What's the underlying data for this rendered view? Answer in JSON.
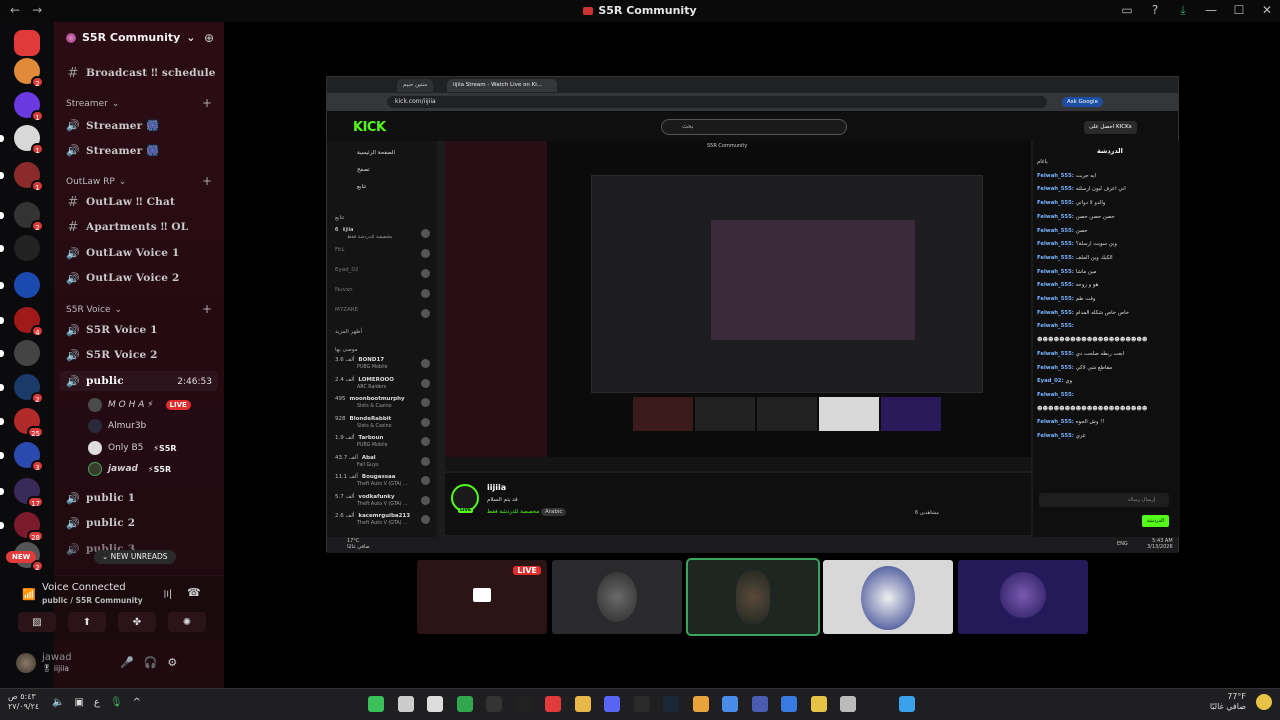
{
  "window": {
    "title": "S5R Community",
    "back": "←",
    "forward": "→",
    "controls": [
      "▭",
      "?",
      "⤓",
      "—",
      "☐",
      "✕"
    ]
  },
  "rail": {
    "servers": [
      {
        "name": "discord-home",
        "color": "#e03a3a",
        "badge": ""
      },
      {
        "name": "server-orange",
        "color": "#e08a3a",
        "badge": "2"
      },
      {
        "name": "server-purple",
        "color": "#6a3ae0",
        "badge": "1"
      },
      {
        "name": "server-white",
        "color": "#d8d8d8",
        "badge": "1"
      },
      {
        "name": "server-red-figure",
        "color": "#8a2a2a",
        "badge": "1"
      },
      {
        "name": "server-dark",
        "color": "#333333",
        "badge": "2"
      },
      {
        "name": "server-vg",
        "color": "#222222",
        "badge": ""
      },
      {
        "name": "server-blue-v",
        "color": "#1a4ab0",
        "badge": ""
      },
      {
        "name": "server-red-wings",
        "color": "#a01a1a",
        "badge": "4"
      },
      {
        "name": "server-northside",
        "color": "#444444",
        "badge": ""
      },
      {
        "name": "server-blue",
        "color": "#1a3a6a",
        "badge": "2"
      },
      {
        "name": "server-red-fire",
        "color": "#b02a2a",
        "badge": "25"
      },
      {
        "name": "server-blue-dots",
        "color": "#2a4ab0",
        "badge": "3"
      },
      {
        "name": "server-purple-2",
        "color": "#3a2a5a",
        "badge": "17"
      },
      {
        "name": "server-red-3",
        "color": "#7a1a2a",
        "badge": "28"
      },
      {
        "name": "server-small",
        "color": "#555555",
        "badge": "2"
      }
    ],
    "new_label": "NEW"
  },
  "sidebar": {
    "guild_name": "S5R Community",
    "channels": [
      {
        "type": "text",
        "label": "Broadcast ‼ schedule"
      },
      {
        "type": "category",
        "label": "Streamer"
      },
      {
        "type": "voice",
        "label": "Streamer 🎆"
      },
      {
        "type": "voice",
        "label": "Streamer 🎆"
      },
      {
        "type": "category",
        "label": "OutLaw RP"
      },
      {
        "type": "text",
        "label": "OutLaw ‼ Chat"
      },
      {
        "type": "text",
        "label": "Apartments ‼ OL"
      },
      {
        "type": "voice",
        "label": "OutLaw Voice 1"
      },
      {
        "type": "voice",
        "label": "OutLaw Voice 2"
      },
      {
        "type": "category",
        "label": "S5R Voice"
      },
      {
        "type": "voice",
        "label": "S5R Voice 1"
      },
      {
        "type": "voice",
        "label": "S5R Voice 2"
      },
      {
        "type": "voice",
        "label": "public"
      },
      {
        "type": "voice",
        "label": "public 1"
      },
      {
        "type": "voice",
        "label": "public 2"
      },
      {
        "type": "voice",
        "label": "public 3"
      }
    ],
    "public_timer": "2:46:53",
    "voice_users": [
      {
        "name": "M O H A ⚡",
        "live": "LIVE",
        "tag": ""
      },
      {
        "name": "Almur3b",
        "live": "",
        "tag": ""
      },
      {
        "name": "Only B5",
        "live": "",
        "tag": "⚡S5R"
      },
      {
        "name": "jawad",
        "live": "",
        "tag": "⚡S5R"
      }
    ],
    "new_unreads": "NEW UNREADS"
  },
  "voice_panel": {
    "title": "Voice Connected",
    "subtitle": "public / S5R Community"
  },
  "user": {
    "name": "jawad",
    "status": "🎖 iijiia"
  },
  "browser": {
    "tabs": [
      "ستين حبيم",
      "iijiia Stream - Watch Live on Ki..."
    ],
    "url": "kick.com/iijiia",
    "ask_google": "Ask Google",
    "kick_logo": "KICK",
    "search_placeholder": "بحث",
    "get_kicks": "احصل على KICKs",
    "side_nav": [
      "الصفحة الرئيسية",
      "تصفح",
      "تتابع"
    ],
    "following_label": "تتابع",
    "channels": [
      {
        "name": "iijiia",
        "sub": "مخصصة للدردشة فقط",
        "count": "6"
      },
      {
        "name": "FitL",
        "sub": "",
        "count": ""
      },
      {
        "name": "Eyad_02",
        "sub": "",
        "count": ""
      },
      {
        "name": "Nuvxn",
        "sub": "",
        "count": ""
      },
      {
        "name": "M7ZARE",
        "sub": "",
        "count": ""
      }
    ],
    "show_more": "أظهر المزيد",
    "recommended_label": "موصى بها",
    "recommended": [
      {
        "count": "3.6 ألف",
        "name": "BOND17",
        "game": "PUBG Mobile"
      },
      {
        "count": "2.4 ألف",
        "name": "LOMEROOO",
        "game": "ARC Raiders"
      },
      {
        "count": "495",
        "name": "moonbootmurphy",
        "game": "Slots & Casino"
      },
      {
        "count": "928",
        "name": "BlondeRabbit",
        "game": "Slots & Casino"
      },
      {
        "count": "1.9 ألف",
        "name": "Tarboun",
        "game": "PUBG Mobile"
      },
      {
        "count": "43.7 ألف",
        "name": "Abal",
        "game": "Fall Guys"
      },
      {
        "count": "11.1 ألف",
        "name": "Bougassaa",
        "game": "Theft Auto V (GTA) ..."
      },
      {
        "count": "5.7 ألف",
        "name": "vodkafunky",
        "game": "Theft Auto V (GTA) ..."
      },
      {
        "count": "2.6 ألف",
        "name": "kacemrguiba213",
        "game": "Theft Auto V (GTA) ..."
      }
    ],
    "nested_title": "S5R Community",
    "stream": {
      "name": "iijiia",
      "title": "قد يتم السلام",
      "category": "مخصصة للدردشة فقط",
      "language": "Arabic",
      "live": "LIVE",
      "viewers": "6 مشاهدين"
    },
    "chat": {
      "title": "الدردشة",
      "lines": [
        {
          "user": "",
          "msg": "ياغام"
        },
        {
          "user": "Felwah_555:",
          "msg": "ايه جربت"
        },
        {
          "user": "Felwah_555:",
          "msg": "اني اعرف ليون ارسلته"
        },
        {
          "user": "Felwah_555:",
          "msg": "والدو لا دواتي"
        },
        {
          "user": "Felwah_555:",
          "msg": "حصن حصن حصن"
        },
        {
          "user": "Felwah_555:",
          "msg": "حصن"
        },
        {
          "user": "Felwah_555:",
          "msg": "وين سويت ارسلة؟"
        },
        {
          "user": "Felwah_555:",
          "msg": "الكيك وين الملف"
        },
        {
          "user": "Felwah_555:",
          "msg": "مين ماشا"
        },
        {
          "user": "Felwah_555:",
          "msg": "هو و زوجه"
        },
        {
          "user": "Felwah_555:",
          "msg": "وقت طم"
        },
        {
          "user": "Felwah_555:",
          "msg": "خاص خاص شكله المدام"
        },
        {
          "user": "Felwah_555:",
          "msg": ""
        },
        {
          "user": "",
          "msg": "☻☻☻☻☻☻☻☻☻☻☻☻☻☻☻☻☻☻☻☻"
        },
        {
          "user": "Felwah_555:",
          "msg": "ابعت ربطه صلحت دي"
        },
        {
          "user": "Felwah_555:",
          "msg": "مقاطع شي لاكي"
        },
        {
          "user": "Eyad_02:",
          "msg": "وي"
        },
        {
          "user": "Felwah_555:",
          "msg": ""
        },
        {
          "user": "",
          "msg": "☻☻☻☻☻☻☻☻☻☻☻☻☻☻☻☻☻☻☻☻"
        },
        {
          "user": "Felwah_555:",
          "msg": "وش الجوه !!"
        },
        {
          "user": "Felwah_555:",
          "msg": "غري"
        }
      ],
      "input_placeholder": "إرسال رسالة",
      "send_label": "الدردشة"
    },
    "taskbar": {
      "temp": "17°C",
      "weather": "صافي غالبًا",
      "lang": "ENG",
      "time": "5:43 AM",
      "date": "3/13/2026"
    }
  },
  "tiles": [
    {
      "name": "tile-stream-live",
      "live": "LIVE"
    },
    {
      "name": "tile-stitch",
      "live": ""
    },
    {
      "name": "tile-man-selected",
      "live": ""
    },
    {
      "name": "tile-helmet",
      "live": ""
    },
    {
      "name": "tile-purple-logo",
      "live": ""
    }
  ],
  "taskbar": {
    "time": "٥:٤٣ ص",
    "date": "٢٧/٠٩/٢٤",
    "lang": "ع",
    "lang2": "اذ",
    "weather_temp": "77°F",
    "weather_text": "صافي غالبًا"
  }
}
